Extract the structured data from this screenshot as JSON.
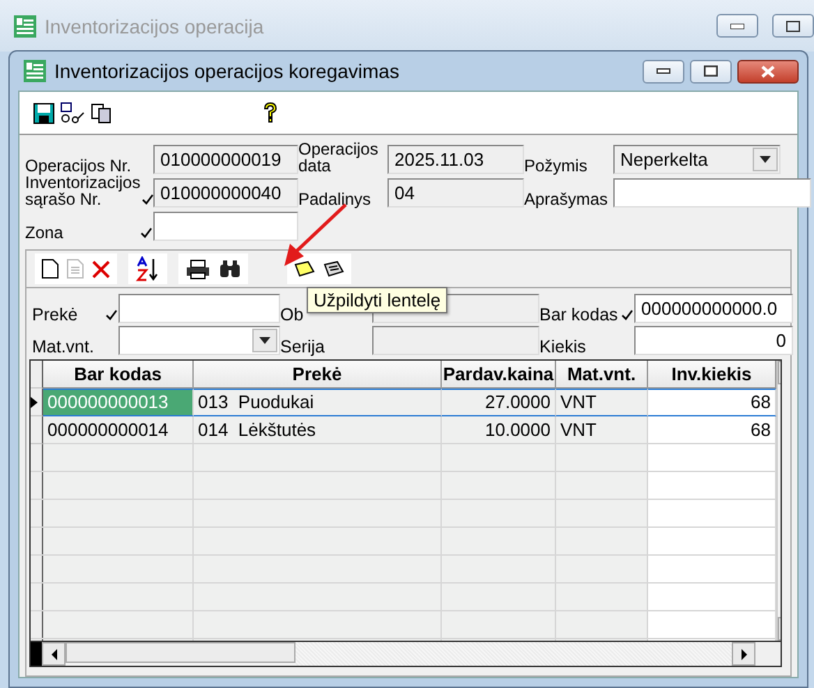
{
  "outer_window": {
    "title": "Inventorizacijos operacija"
  },
  "window": {
    "title": "Inventorizacijos operacijos koregavimas"
  },
  "header_fields": [
    {
      "label": "Operacijos Nr.",
      "value": "010000000019",
      "required": false,
      "readonly": true,
      "kind": "text"
    },
    {
      "label": "Operacijos data",
      "value": "2025.11.03",
      "required": false,
      "readonly": true,
      "kind": "text"
    },
    {
      "label": "Požymis",
      "value": "Neperkelta",
      "required": false,
      "readonly": true,
      "kind": "dropdown"
    },
    {
      "label": "Inventorizacijos sąrašo Nr.",
      "value": "010000000040",
      "required": true,
      "readonly": true,
      "kind": "text"
    },
    {
      "label": "Padalinys",
      "value": "04",
      "required": false,
      "readonly": true,
      "kind": "text"
    },
    {
      "label": "Aprašymas",
      "required": false,
      "readonly": false,
      "kind": "text"
    },
    {
      "label": "Zona",
      "required": true,
      "readonly": false,
      "kind": "text"
    }
  ],
  "detail_fields": [
    {
      "label": "Prekė",
      "required": true,
      "readonly": false,
      "kind": "text"
    },
    {
      "label": "Ob",
      "required": false,
      "readonly": true,
      "kind": "text"
    },
    {
      "label": "Bar kodas",
      "value": "000000000000.0",
      "required": true,
      "readonly": false,
      "kind": "text"
    },
    {
      "label": "Mat.vnt.",
      "required": false,
      "readonly": false,
      "kind": "dropdown"
    },
    {
      "label": "Serija",
      "required": false,
      "readonly": true,
      "kind": "text"
    },
    {
      "label": "Kiekis",
      "value": "0",
      "required": false,
      "readonly": false,
      "kind": "number"
    }
  ],
  "tooltip": "Užpildyti lentelę",
  "table": {
    "columns": [
      {
        "label": "Bar kodas",
        "kind": "text",
        "editable": false
      },
      {
        "label": "Prekė",
        "kind": "text",
        "editable": false
      },
      {
        "label": "Pardav.kaina",
        "kind": "number",
        "editable": false
      },
      {
        "label": "Mat.vnt.",
        "kind": "text",
        "editable": false
      },
      {
        "label": "Inv.kiekis",
        "kind": "number",
        "editable": true
      }
    ],
    "rows": [
      {
        "selected": true,
        "cells": [
          "000000000013",
          "013  Puodukai",
          "27.0000",
          "VNT",
          "68"
        ]
      },
      {
        "selected": false,
        "cells": [
          "000000000014",
          "014  Lėkštutės",
          "10.0000",
          "VNT",
          "68"
        ]
      }
    ]
  }
}
